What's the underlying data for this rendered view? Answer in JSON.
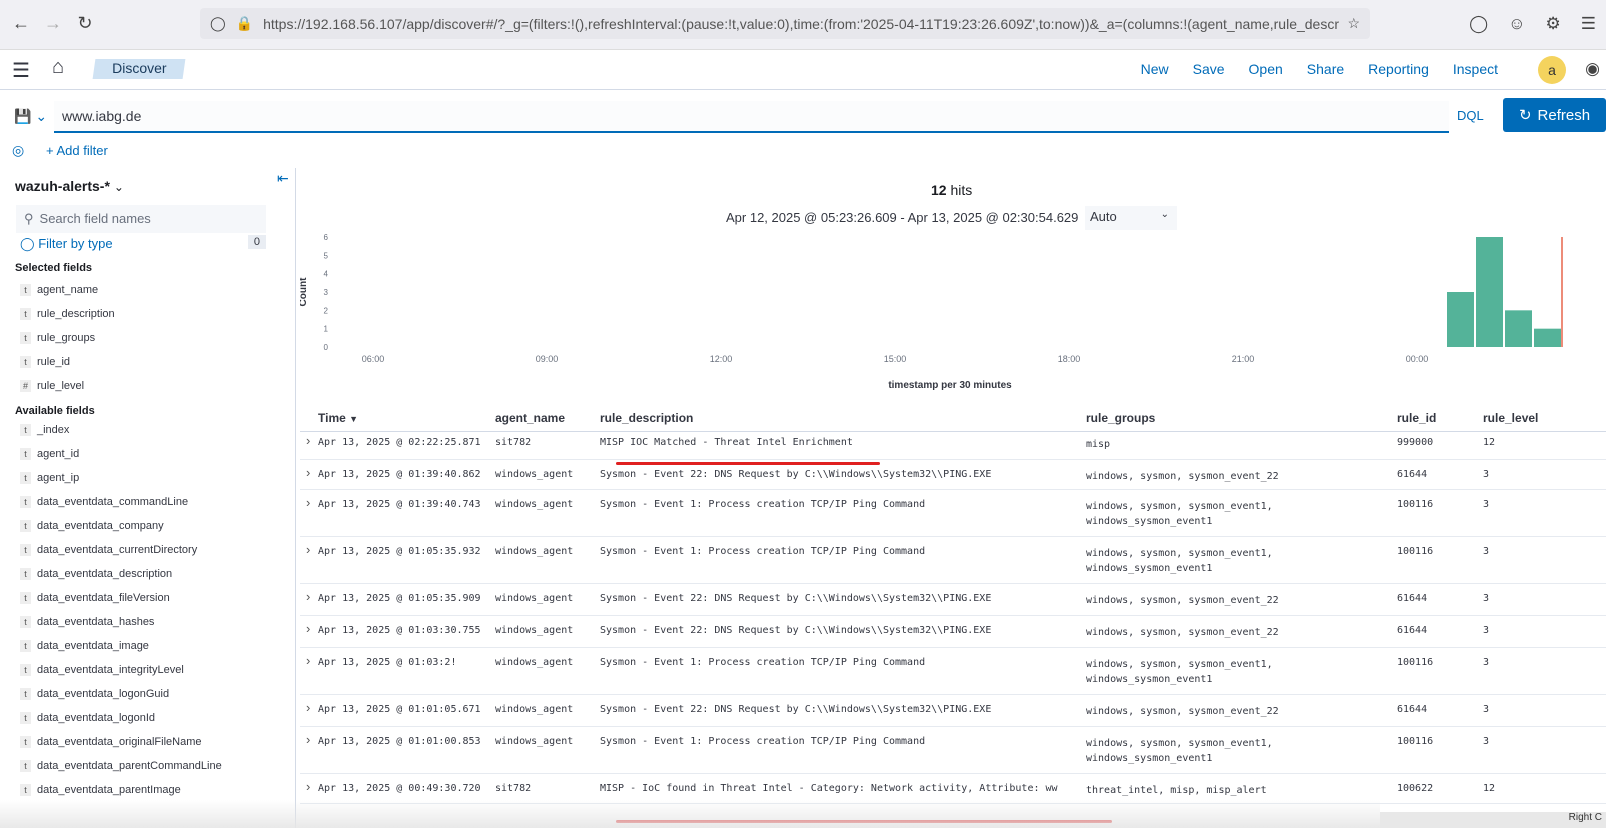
{
  "browser": {
    "url": "https://192.168.56.107/app/discover#/?_g=(filters:!(),refreshInterval:(pause:!t,value:0),time:(from:'2025-04-11T19:23:26.609Z',to:now))&_a=(columns:!(agent_name,rule_description"
  },
  "header": {
    "breadcrumb": "Discover",
    "links": [
      "New",
      "Save",
      "Open",
      "Share",
      "Reporting",
      "Inspect"
    ],
    "avatar": "a"
  },
  "query": {
    "value": "www.iabg.de",
    "language": "DQL",
    "refresh_label": "Refresh",
    "add_filter": "+ Add filter"
  },
  "sidebar": {
    "index_pattern": "wazuh-alerts-*",
    "search_placeholder": "Search field names",
    "filter_by_type": "Filter by type",
    "filter_count": "0",
    "selected_title": "Selected fields",
    "selected_fields": [
      {
        "type": "t",
        "name": "agent_name"
      },
      {
        "type": "t",
        "name": "rule_description"
      },
      {
        "type": "t",
        "name": "rule_groups"
      },
      {
        "type": "t",
        "name": "rule_id"
      },
      {
        "type": "#",
        "name": "rule_level"
      }
    ],
    "available_title": "Available fields",
    "available_fields": [
      {
        "type": "t",
        "name": "_index"
      },
      {
        "type": "t",
        "name": "agent_id"
      },
      {
        "type": "t",
        "name": "agent_ip"
      },
      {
        "type": "t",
        "name": "data_eventdata_commandLine"
      },
      {
        "type": "t",
        "name": "data_eventdata_company"
      },
      {
        "type": "t",
        "name": "data_eventdata_currentDirectory"
      },
      {
        "type": "t",
        "name": "data_eventdata_description"
      },
      {
        "type": "t",
        "name": "data_eventdata_fileVersion"
      },
      {
        "type": "t",
        "name": "data_eventdata_hashes"
      },
      {
        "type": "t",
        "name": "data_eventdata_image"
      },
      {
        "type": "t",
        "name": "data_eventdata_integrityLevel"
      },
      {
        "type": "t",
        "name": "data_eventdata_logonGuid"
      },
      {
        "type": "t",
        "name": "data_eventdata_logonId"
      },
      {
        "type": "t",
        "name": "data_eventdata_originalFileName"
      },
      {
        "type": "t",
        "name": "data_eventdata_parentCommandLine"
      },
      {
        "type": "t",
        "name": "data_eventdata_parentImage"
      }
    ]
  },
  "main": {
    "hits": "12",
    "hits_label": "hits",
    "range": "Apr 12, 2025 @ 05:23:26.609 - Apr 13, 2025 @ 02:30:54.629",
    "interval": "Auto",
    "columns": [
      "Time",
      "agent_name",
      "rule_description",
      "rule_groups",
      "rule_id",
      "rule_level"
    ],
    "rows": [
      {
        "time": "Apr 13, 2025 @ 02:22:25.871",
        "agent": "sit782",
        "desc": "MISP IOC Matched - Threat Intel Enrichment",
        "groups": "misp",
        "id": "999000",
        "level": "12"
      },
      {
        "time": "Apr 13, 2025 @ 01:39:40.862",
        "agent": "windows_agent",
        "desc": "Sysmon - Event 22: DNS Request by C:\\\\Windows\\\\System32\\\\PING.EXE",
        "groups": "windows, sysmon, sysmon_event_22",
        "id": "61644",
        "level": "3"
      },
      {
        "time": "Apr 13, 2025 @ 01:39:40.743",
        "agent": "windows_agent",
        "desc": "Sysmon - Event 1: Process creation TCP/IP Ping Command",
        "groups": "windows, sysmon, sysmon_event1, windows_sysmon_event1",
        "id": "100116",
        "level": "3"
      },
      {
        "time": "Apr 13, 2025 @ 01:05:35.932",
        "agent": "windows_agent",
        "desc": "Sysmon - Event 1: Process creation TCP/IP Ping Command",
        "groups": "windows, sysmon, sysmon_event1, windows_sysmon_event1",
        "id": "100116",
        "level": "3"
      },
      {
        "time": "Apr 13, 2025 @ 01:05:35.909",
        "agent": "windows_agent",
        "desc": "Sysmon - Event 22: DNS Request by C:\\\\Windows\\\\System32\\\\PING.EXE",
        "groups": "windows, sysmon, sysmon_event_22",
        "id": "61644",
        "level": "3"
      },
      {
        "time": "Apr 13, 2025 @ 01:03:30.755",
        "agent": "windows_agent",
        "desc": "Sysmon - Event 22: DNS Request by C:\\\\Windows\\\\System32\\\\PING.EXE",
        "groups": "windows, sysmon, sysmon_event_22",
        "id": "61644",
        "level": "3"
      },
      {
        "time": "Apr 13, 2025 @ 01:03:2!",
        "agent": "windows_agent",
        "desc": "Sysmon - Event 1: Process creation TCP/IP Ping Command",
        "groups": "windows, sysmon, sysmon_event1, windows_sysmon_event1",
        "id": "100116",
        "level": "3"
      },
      {
        "time": "Apr 13, 2025 @ 01:01:05.671",
        "agent": "windows_agent",
        "desc": "Sysmon - Event 22: DNS Request by C:\\\\Windows\\\\System32\\\\PING.EXE",
        "groups": "windows, sysmon, sysmon_event_22",
        "id": "61644",
        "level": "3"
      },
      {
        "time": "Apr 13, 2025 @ 01:01:00.853",
        "agent": "windows_agent",
        "desc": "Sysmon - Event 1: Process creation TCP/IP Ping Command",
        "groups": "windows, sysmon, sysmon_event1, windows_sysmon_event1",
        "id": "100116",
        "level": "3"
      },
      {
        "time": "Apr 13, 2025 @ 00:49:30.720",
        "agent": "sit782",
        "desc": "MISP - IoC found in Threat Intel - Category: Network activity, Attribute: ww",
        "groups": "threat_intel, misp, misp_alert",
        "id": "100622",
        "level": "12"
      }
    ]
  },
  "chart_data": {
    "type": "bar",
    "title": "",
    "xlabel": "timestamp per 30 minutes",
    "ylabel": "Count",
    "ylim": [
      0,
      6
    ],
    "yticks": [
      "0",
      "1",
      "2",
      "3",
      "4",
      "5",
      "6"
    ],
    "xticks": [
      "06:00",
      "09:00",
      "12:00",
      "15:00",
      "18:00",
      "21:00",
      "00:00"
    ],
    "categories": [
      "00:30",
      "01:00",
      "01:30",
      "02:00"
    ],
    "values": [
      3,
      6,
      2,
      1
    ],
    "color": "#54b399",
    "now_marker_color": "#e7664c"
  },
  "status": {
    "taskbar": "Right C"
  }
}
